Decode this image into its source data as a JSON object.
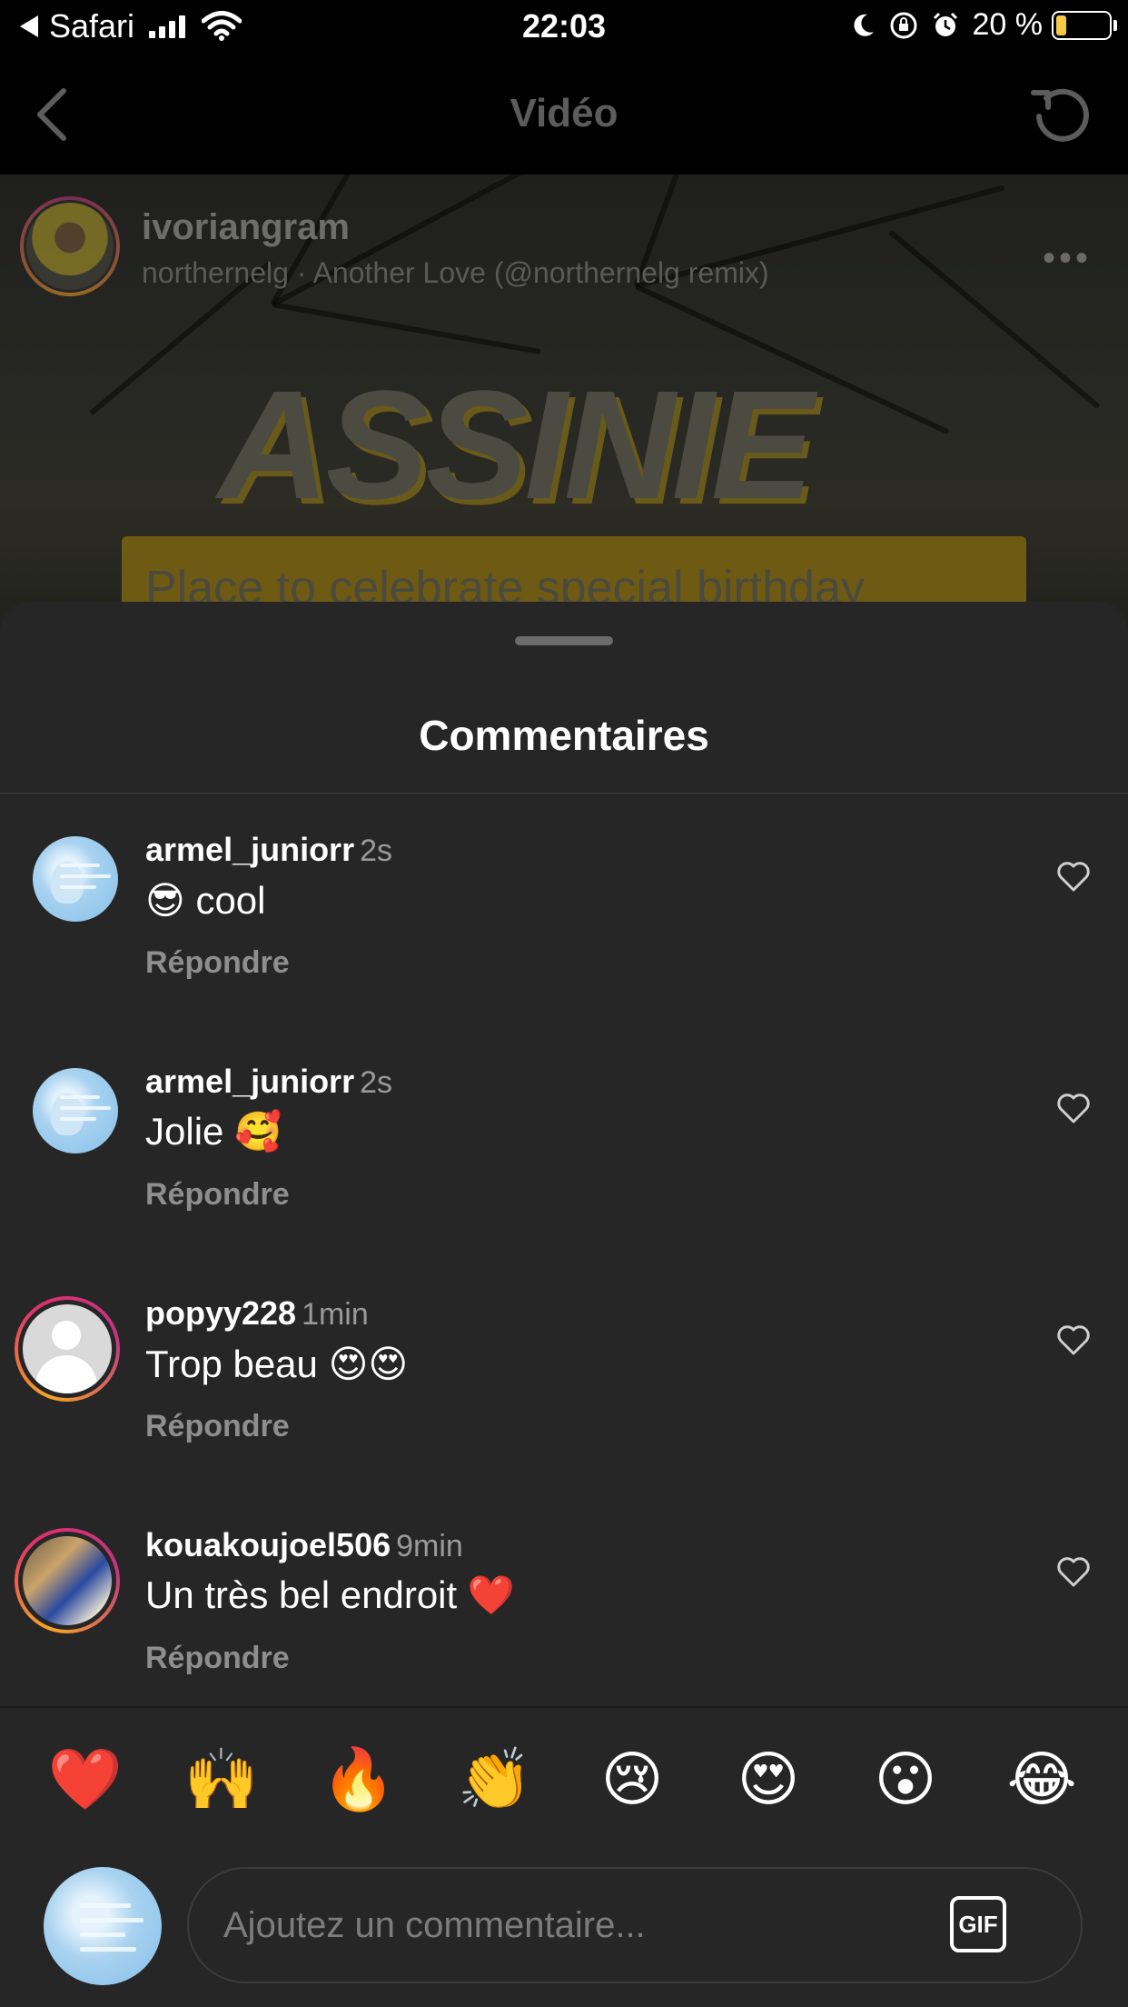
{
  "status_bar": {
    "back_app": "Safari",
    "time": "22:03",
    "battery": "20 %"
  },
  "nav": {
    "title": "Vidéo"
  },
  "post": {
    "owner": "ivoriangram",
    "music": "northernelg · Another Love (@northernelg remix)",
    "overlay_title": "ASSINIE",
    "overlay_banner": "Place to celebrate special birthday"
  },
  "sheet": {
    "title": "Commentaires"
  },
  "comments": [
    {
      "user": "armel_juniorr",
      "time": "2s",
      "text": "😎 cool",
      "reply": "Répondre"
    },
    {
      "user": "armel_juniorr",
      "time": "2s",
      "text": "Jolie 🥰",
      "reply": "Répondre"
    },
    {
      "user": "popyy228",
      "time": "1min",
      "text": "Trop beau 😍😍",
      "reply": "Répondre"
    },
    {
      "user": "kouakoujoel506",
      "time": "9min",
      "text": "Un très bel endroit ❤️",
      "reply": "Répondre"
    }
  ],
  "quick_reactions": [
    "❤️",
    "🙌",
    "🔥",
    "👏",
    "😢",
    "😍",
    "😮",
    "😂"
  ],
  "composer": {
    "placeholder": "Ajoutez un commentaire...",
    "gif_label": "GIF"
  },
  "colors": {
    "sheet_bg": "#262626",
    "muted_text": "#8e8e8e",
    "story_ring": "#e1306c"
  }
}
